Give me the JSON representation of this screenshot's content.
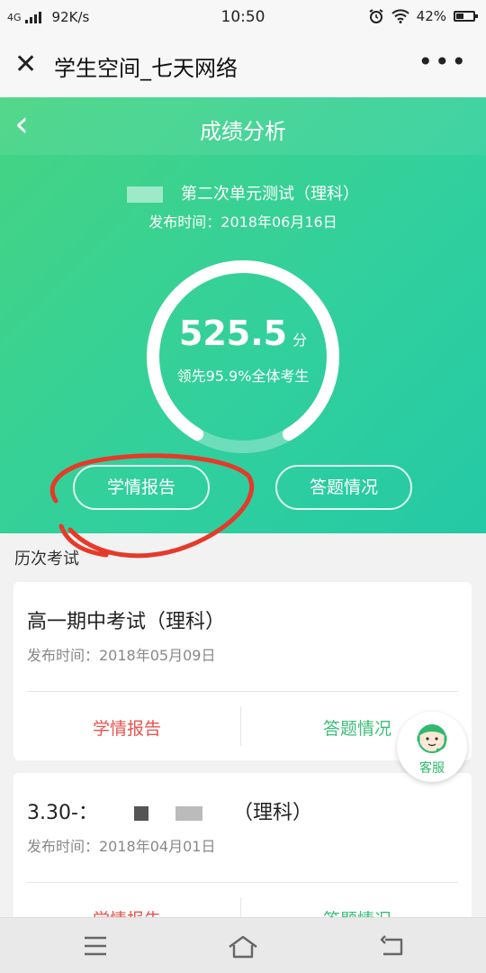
{
  "status_bar": {
    "network": "4G",
    "speed": "92K/s",
    "time": "10:50",
    "battery": "42%",
    "icons": [
      "signal-icon",
      "alarm-icon",
      "wifi-icon",
      "battery-icon"
    ]
  },
  "browser": {
    "title": "学生空间_七天网络",
    "close_icon": "close-icon",
    "more_icon": "more-icon"
  },
  "page": {
    "title": "成绩分析",
    "back_icon": "chevron-left-icon"
  },
  "current_exam": {
    "name": "第二次单元测试（理科）",
    "publish_time": "发布时间：2018年06月16日",
    "score": "525.5",
    "score_unit": "分",
    "rank_text": "领先95.9%全体考生",
    "ring_fraction": 0.83,
    "report_label": "学情报告",
    "answers_label": "答题情况"
  },
  "history": {
    "section_label": "历次考试",
    "items": [
      {
        "name": "高一期中考试（理科）",
        "publish_time": "发布时间：2018年05月09日",
        "report_label": "学情报告",
        "answers_label": "答题情况"
      },
      {
        "name_prefix": "3.30-：",
        "name_suffix": "（理科）",
        "publish_time": "发布时间：2018年04月01日",
        "report_label": "学情报告",
        "answers_label": "答题情况"
      }
    ]
  },
  "support": {
    "label": "客服",
    "icon": "customer-service-icon"
  },
  "colors": {
    "accent_green": "#3cbf7a",
    "report_red": "#e8544d",
    "hero_start": "#45d482",
    "hero_end": "#24c9a5",
    "annotation_red": "#e53a2a"
  },
  "nav_bar": {
    "icons": [
      "menu-icon",
      "home-icon",
      "back-icon"
    ]
  }
}
